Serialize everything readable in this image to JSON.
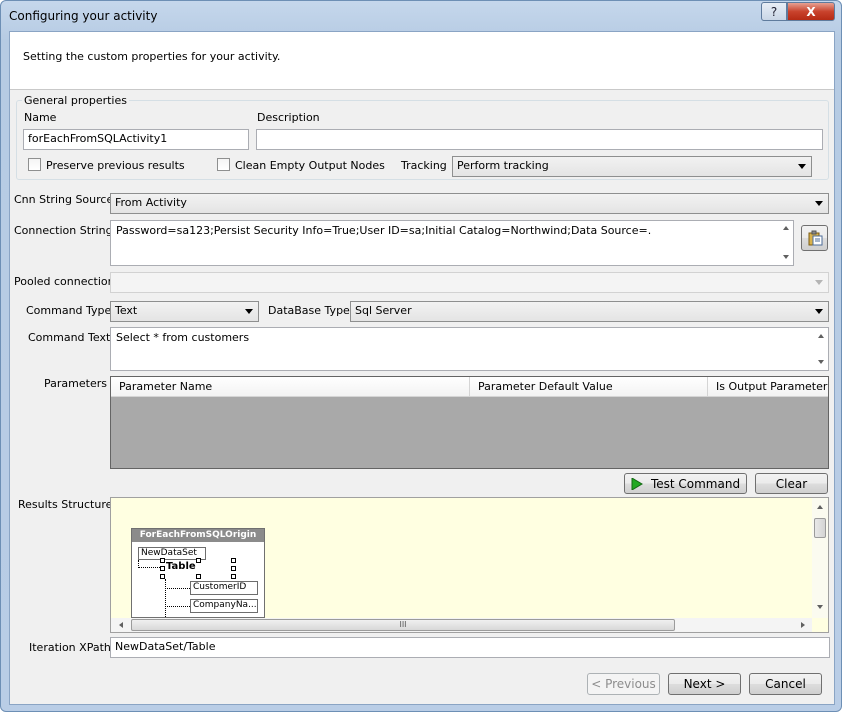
{
  "window": {
    "title": "Configuring your activity",
    "help_label": "?",
    "close_label": "X"
  },
  "header": {
    "subtitle": "Setting the custom properties for your activity."
  },
  "general": {
    "group_title": "General properties",
    "name_label": "Name",
    "name_value": "forEachFromSQLActivity1",
    "description_label": "Description",
    "description_value": "",
    "preserve_label": "Preserve previous results",
    "clean_label": "Clean Empty Output Nodes",
    "tracking_label": "Tracking",
    "tracking_value": "Perform tracking"
  },
  "cnn": {
    "source_label": "Cnn String Source",
    "source_value": "From Activity",
    "connection_label": "Connection String",
    "connection_value": "Password=sa123;Persist Security Info=True;User ID=sa;Initial Catalog=Northwind;Data Source=.",
    "pooled_label": "Pooled connection",
    "pooled_value": ""
  },
  "command": {
    "type_label": "Command Type",
    "type_value": "Text",
    "dbtype_label": "DataBase Type",
    "dbtype_value": "Sql Server",
    "text_label": "Command Text",
    "text_value": "Select * from customers"
  },
  "parameters": {
    "label": "Parameters",
    "columns": [
      "Parameter Name",
      "Parameter Default Value",
      "Is Output Parameter"
    ]
  },
  "buttons": {
    "test_command": "Test Command",
    "clear": "Clear",
    "previous": "< Previous",
    "next": "Next >",
    "cancel": "Cancel"
  },
  "results": {
    "label": "Results Structure",
    "root": "ForEachFromSQLOrigin",
    "dataset": "NewDataSet",
    "table": "Table",
    "fields": [
      "CustomerID",
      "CompanyNa..."
    ],
    "hscroll_grip": "III"
  },
  "iteration": {
    "label": "Iteration XPath",
    "value": "NewDataSet/Table"
  },
  "colors": {
    "title_bg": "#b9cde6",
    "client_bg": "#f0f0f0",
    "results_bg": "#ffffe1",
    "grid_bg": "#a9a9a9",
    "close_red": "#c9432d",
    "play_green": "#22a822"
  }
}
